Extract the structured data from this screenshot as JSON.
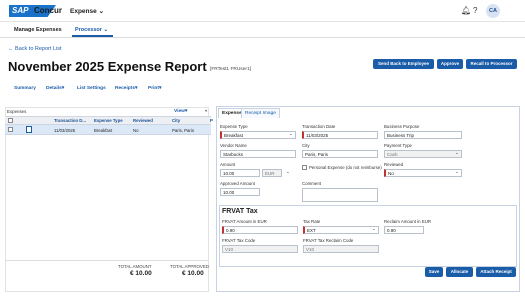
{
  "brand": {
    "sap": "SAP",
    "concur": "Concur",
    "menu": "Expense"
  },
  "nav": {
    "manage": "Manage Expenses",
    "processor": "Processor"
  },
  "header": {
    "avatar": "CA"
  },
  "report": {
    "back": "Back to Report List",
    "title": "November 2025 Expense Report",
    "subtitle": "[FRTest1 FRUser1]"
  },
  "buttons": {
    "send": "Send Back to Employee",
    "approve": "Approve",
    "recall": "Recall to Processor",
    "save": "Save",
    "allocate": "Allocate",
    "attach": "Attach Receipt"
  },
  "menus": [
    "Summary",
    "Details",
    "List Settings",
    "Receipts",
    "Print"
  ],
  "expenses": {
    "label": "Expenses",
    "view": "View",
    "headers": [
      "Transaction D...",
      "Expense Type",
      "Reviewed",
      "City",
      "P"
    ],
    "rows": [
      {
        "date": "11/03/2025",
        "type": "Breakfast",
        "reviewed": "No",
        "city": "Paris, Paris"
      }
    ]
  },
  "totals": {
    "amount_label": "TOTAL AMOUNT",
    "amount": "€ 10.00",
    "approved_label": "TOTAL APPROVED",
    "approved": "€ 10.00"
  },
  "tabs": [
    "Expense",
    "Receipt Image"
  ],
  "form": {
    "expense_type": {
      "label": "Expense Type",
      "value": "Breakfast"
    },
    "transaction_date": {
      "label": "Transaction Date",
      "value": "11/03/2025"
    },
    "business_purpose": {
      "label": "Business Purpose",
      "value": "Business Trip"
    },
    "vendor": {
      "label": "Vendor Name",
      "value": "Starbucks"
    },
    "city": {
      "label": "City",
      "value": "Paris, Paris"
    },
    "payment": {
      "label": "Payment Type",
      "value": "Cash"
    },
    "amount": {
      "label": "Amount",
      "value": "10.00",
      "currency": "EUR"
    },
    "personal": {
      "label": "Personal Expense (do not reimburse)"
    },
    "reviewed": {
      "label": "Reviewed",
      "value": "No"
    },
    "approved": {
      "label": "Approved Amount",
      "value": "10.00"
    },
    "comment": {
      "label": "Comment"
    }
  },
  "frvat": {
    "title": "FRVAT Tax",
    "amount": {
      "label": "FRVAT Amount in EUR",
      "value": "0.90"
    },
    "rate": {
      "label": "Tax Rate",
      "value": "EXT"
    },
    "reclaim": {
      "label": "Reclaim Amount in EUR",
      "value": "0.90"
    },
    "code": {
      "label": "FRVAT Tax Code",
      "value": "V10"
    },
    "reclaim_code": {
      "label": "FRVAT Tax Reclaim Code",
      "value": "V10"
    }
  }
}
